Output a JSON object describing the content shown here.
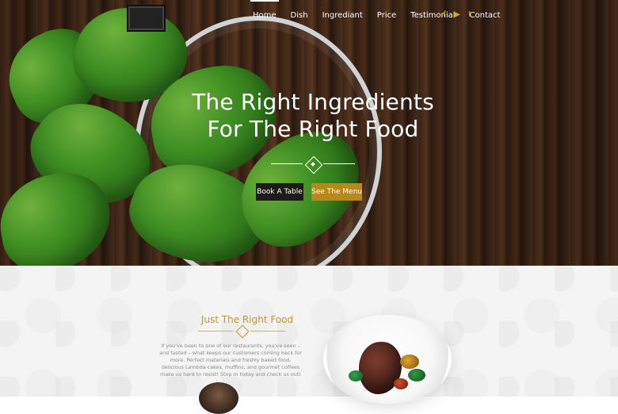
{
  "header": {
    "logo_alt": "",
    "nav": [
      {
        "label": "Home",
        "active": true
      },
      {
        "label": "Dish",
        "active": false
      },
      {
        "label": "Ingrediant",
        "active": false
      },
      {
        "label": "Price",
        "active": false
      },
      {
        "label": "Testimonial",
        "active": false
      },
      {
        "label": "Contact",
        "active": false
      }
    ],
    "social_icons": [
      "facebook-icon",
      "youtube-icon",
      "twitter-icon"
    ],
    "social_glyphs": [
      "f",
      "▶",
      "t"
    ],
    "accent_color": "#c5952a"
  },
  "hero": {
    "title_line1": "The Right Ingredients",
    "title_line2": "For The Right Food",
    "buttons": {
      "book": "Book A Table",
      "menu": "See The Menu"
    }
  },
  "about": {
    "title": "Just The Right Food",
    "body": "If you’ve been to one of our restaurants, you’ve seen – and tasted – what keeps our customers coming back for more. Perfect materials and freshly baked food, delicious Lambda cakes, muffins, and gourmet coffees make us hard to resist! Stop in today and check us out!"
  }
}
